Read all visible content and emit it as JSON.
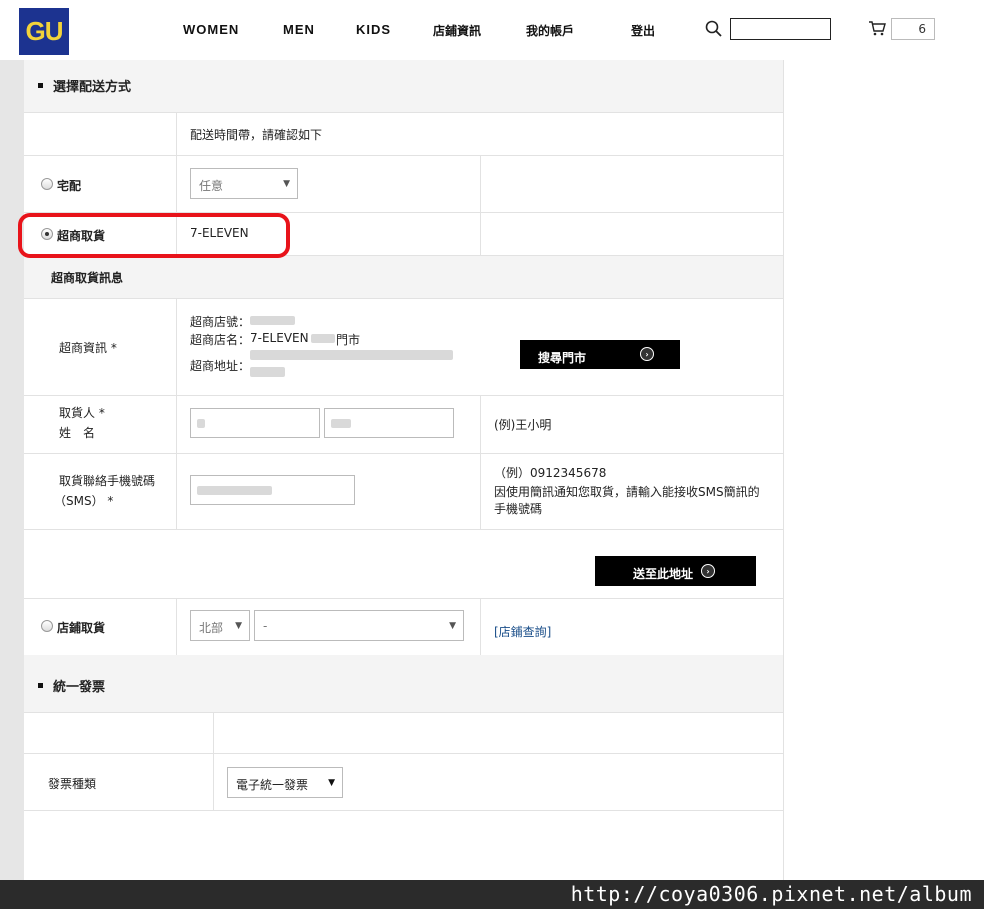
{
  "header": {
    "logo": "GU",
    "nav": [
      "WOMEN",
      "MEN",
      "KIDS",
      "店鋪資訊",
      "我的帳戶",
      "登出"
    ],
    "cart_count": "6",
    "brand_color": "#1c3390",
    "logo_text_color": "#f2d33a"
  },
  "delivery": {
    "section_title": "選擇配送方式",
    "time_note": "配送時間帶，請確認如下",
    "home": {
      "label": "宅配",
      "time_select": "任意",
      "selected": false
    },
    "cvs": {
      "label": "超商取貨",
      "store_brand": "7-ELEVEN",
      "selected": true
    },
    "cvs_info": {
      "title": "超商取貨訊息",
      "store_label": "超商資訊 *",
      "store_no_label": "超商店號：",
      "store_name_label": "超商店名：",
      "store_name_value": "7-ELEVEN",
      "store_name_suffix": "門市",
      "store_addr_label": "超商地址：",
      "search_button": "搜尋門市",
      "recipient_label_1": "取貨人 *",
      "recipient_label_2": "姓　名",
      "recipient_example": "(例)王小明",
      "phone_label_1": "取貨聯絡手機號碼",
      "phone_label_2": "（SMS） *",
      "phone_example": "（例）0912345678",
      "phone_note_1": "因使用簡訊通知您取貨，請輸入能接收SMS簡訊的",
      "phone_note_2": "手機號碼",
      "submit_button": "送至此地址"
    },
    "store_pickup": {
      "label": "店鋪取貨",
      "region_select": "北部",
      "store_select": "-",
      "store_link": "[店鋪查詢]",
      "selected": false
    }
  },
  "invoice": {
    "section_title": "統一發票",
    "type_label": "發票種類",
    "type_select": "電子統一發票"
  },
  "watermark": "http://coya0306.pixnet.net/album",
  "accent_color": "#e8131a"
}
